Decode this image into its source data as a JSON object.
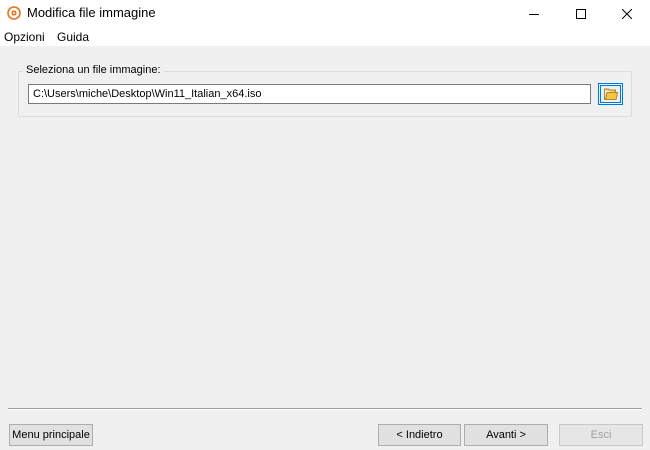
{
  "window": {
    "title": "Modifica file immagine",
    "icon": "disc-icon"
  },
  "menu": {
    "items": [
      "Opzioni",
      "Guida"
    ]
  },
  "image_group": {
    "legend": "Seleziona un file immagine:",
    "path_value": "C:\\Users\\miche\\Desktop\\Win11_Italian_x64.iso",
    "browse_icon": "folder-icon"
  },
  "footer": {
    "main_menu_label": "Menu principale",
    "back_label": "< Indietro",
    "next_label": "Avanti >",
    "exit_label": "Esci"
  },
  "colors": {
    "accent": "#0078d7",
    "icon_orange": "#e8731a",
    "folder_yellow": "#f5c542"
  }
}
